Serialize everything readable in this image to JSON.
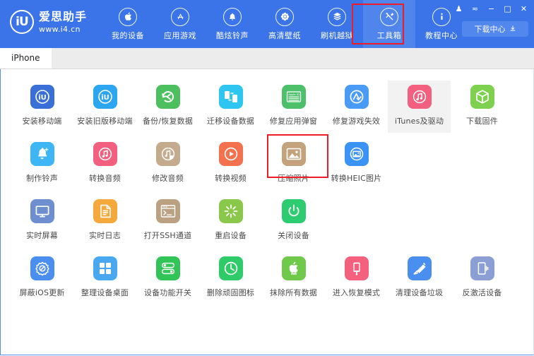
{
  "brand": {
    "logo_text": "iU",
    "name": "爱思助手",
    "url": "www.i4.cn"
  },
  "header": {
    "accent_color": "#3b73e8",
    "active_color": "#5086ec",
    "highlight_color": "#ee1c25",
    "nav": [
      {
        "label": "我的设备",
        "icon": "apple-icon",
        "active": false
      },
      {
        "label": "应用游戏",
        "icon": "app-store-icon",
        "active": false
      },
      {
        "label": "酷炫铃声",
        "icon": "bell-icon",
        "active": false
      },
      {
        "label": "高清壁纸",
        "icon": "flower-icon",
        "active": false
      },
      {
        "label": "刷机越狱",
        "icon": "flash-layers-icon",
        "active": false
      },
      {
        "label": "工具箱",
        "icon": "tools-icon",
        "active": true
      },
      {
        "label": "教程中心",
        "icon": "info-icon",
        "active": false
      }
    ],
    "window_controls": [
      {
        "name": "skin-icon",
        "glyph": "♟"
      },
      {
        "name": "menu-icon",
        "glyph": "≂"
      },
      {
        "name": "minimize-icon",
        "glyph": "−"
      },
      {
        "name": "maximize-icon",
        "glyph": "□"
      },
      {
        "name": "close-icon",
        "glyph": "✕"
      }
    ],
    "download_button": {
      "label": "下载中心",
      "icon": "download-icon"
    }
  },
  "tabs": [
    {
      "label": "iPhone",
      "active": true
    }
  ],
  "toolbox": {
    "rows": [
      [
        {
          "label": "安装移动端",
          "icon": "i4-app-icon",
          "color": "#3a6fd8",
          "hover": false
        },
        {
          "label": "安装旧版移动端",
          "icon": "i4-app-old-icon",
          "color": "#2ca6f0",
          "hover": false
        },
        {
          "label": "备份/恢复数据",
          "icon": "backup-restore-icon",
          "color": "#4cc05e",
          "hover": false
        },
        {
          "label": "迁移设备数据",
          "icon": "migrate-data-icon",
          "color": "#2ec5f0",
          "hover": false
        },
        {
          "label": "修复应用弹窗",
          "icon": "apple-id-card-icon",
          "color": "#4cc06a",
          "hover": false
        },
        {
          "label": "修复游戏失效",
          "icon": "app-store-check-icon",
          "color": "#4a9bf5",
          "hover": false
        },
        {
          "label": "iTunes及驱动",
          "icon": "itunes-icon",
          "color": "#f3607f",
          "hover": true
        },
        {
          "label": "下载固件",
          "icon": "firmware-cube-icon",
          "color": "#7ed04f",
          "hover": false
        }
      ],
      [
        {
          "label": "制作铃声",
          "icon": "ringtone-bell-icon",
          "color": "#3eb6f5",
          "hover": false
        },
        {
          "label": "转换音频",
          "icon": "audio-convert-icon",
          "color": "#f3607f",
          "hover": false
        },
        {
          "label": "修改音频",
          "icon": "audio-edit-icon",
          "color": "#c4ab8d",
          "hover": false
        },
        {
          "label": "转换视频",
          "icon": "video-convert-icon",
          "color": "#f4714f",
          "hover": false
        },
        {
          "label": "压缩照片",
          "icon": "compress-photo-icon",
          "color": "#c4a37c",
          "hover": false,
          "highlighted": true
        },
        {
          "label": "转换HEIC图片",
          "icon": "heic-convert-icon",
          "color": "#3b93f5",
          "hover": false
        }
      ],
      [
        {
          "label": "实时屏幕",
          "icon": "live-screen-icon",
          "color": "#6d8fd0",
          "hover": false
        },
        {
          "label": "实时日志",
          "icon": "live-log-icon",
          "color": "#f5a93c",
          "hover": false
        },
        {
          "label": "打开SSH通道",
          "icon": "ssh-terminal-icon",
          "color": "#bba181",
          "hover": false
        },
        {
          "label": "重启设备",
          "icon": "reboot-icon",
          "color": "#8ac84b",
          "hover": false
        },
        {
          "label": "关闭设备",
          "icon": "power-off-icon",
          "color": "#2ecc71",
          "hover": false
        }
      ],
      [
        {
          "label": "屏蔽iOS更新",
          "icon": "block-update-icon",
          "color": "#4a8ef0",
          "hover": false
        },
        {
          "label": "整理设备桌面",
          "icon": "arrange-home-icon",
          "color": "#4aa8f0",
          "hover": false
        },
        {
          "label": "设备功能开关",
          "icon": "feature-toggle-icon",
          "color": "#31c456",
          "hover": false
        },
        {
          "label": "删除顽固图标",
          "icon": "remove-icon-icon",
          "color": "#2ecb68",
          "hover": false
        },
        {
          "label": "抹除所有数据",
          "icon": "erase-data-icon",
          "color": "#6fc94a",
          "hover": false
        },
        {
          "label": "进入恢复模式",
          "icon": "recovery-mode-icon",
          "color": "#f4617e",
          "hover": false
        },
        {
          "label": "清理设备垃圾",
          "icon": "clean-junk-icon",
          "color": "#4a8ef0",
          "hover": false
        },
        {
          "label": "反激活设备",
          "icon": "deactivate-icon",
          "color": "#8b9fd4",
          "hover": false
        }
      ]
    ]
  }
}
